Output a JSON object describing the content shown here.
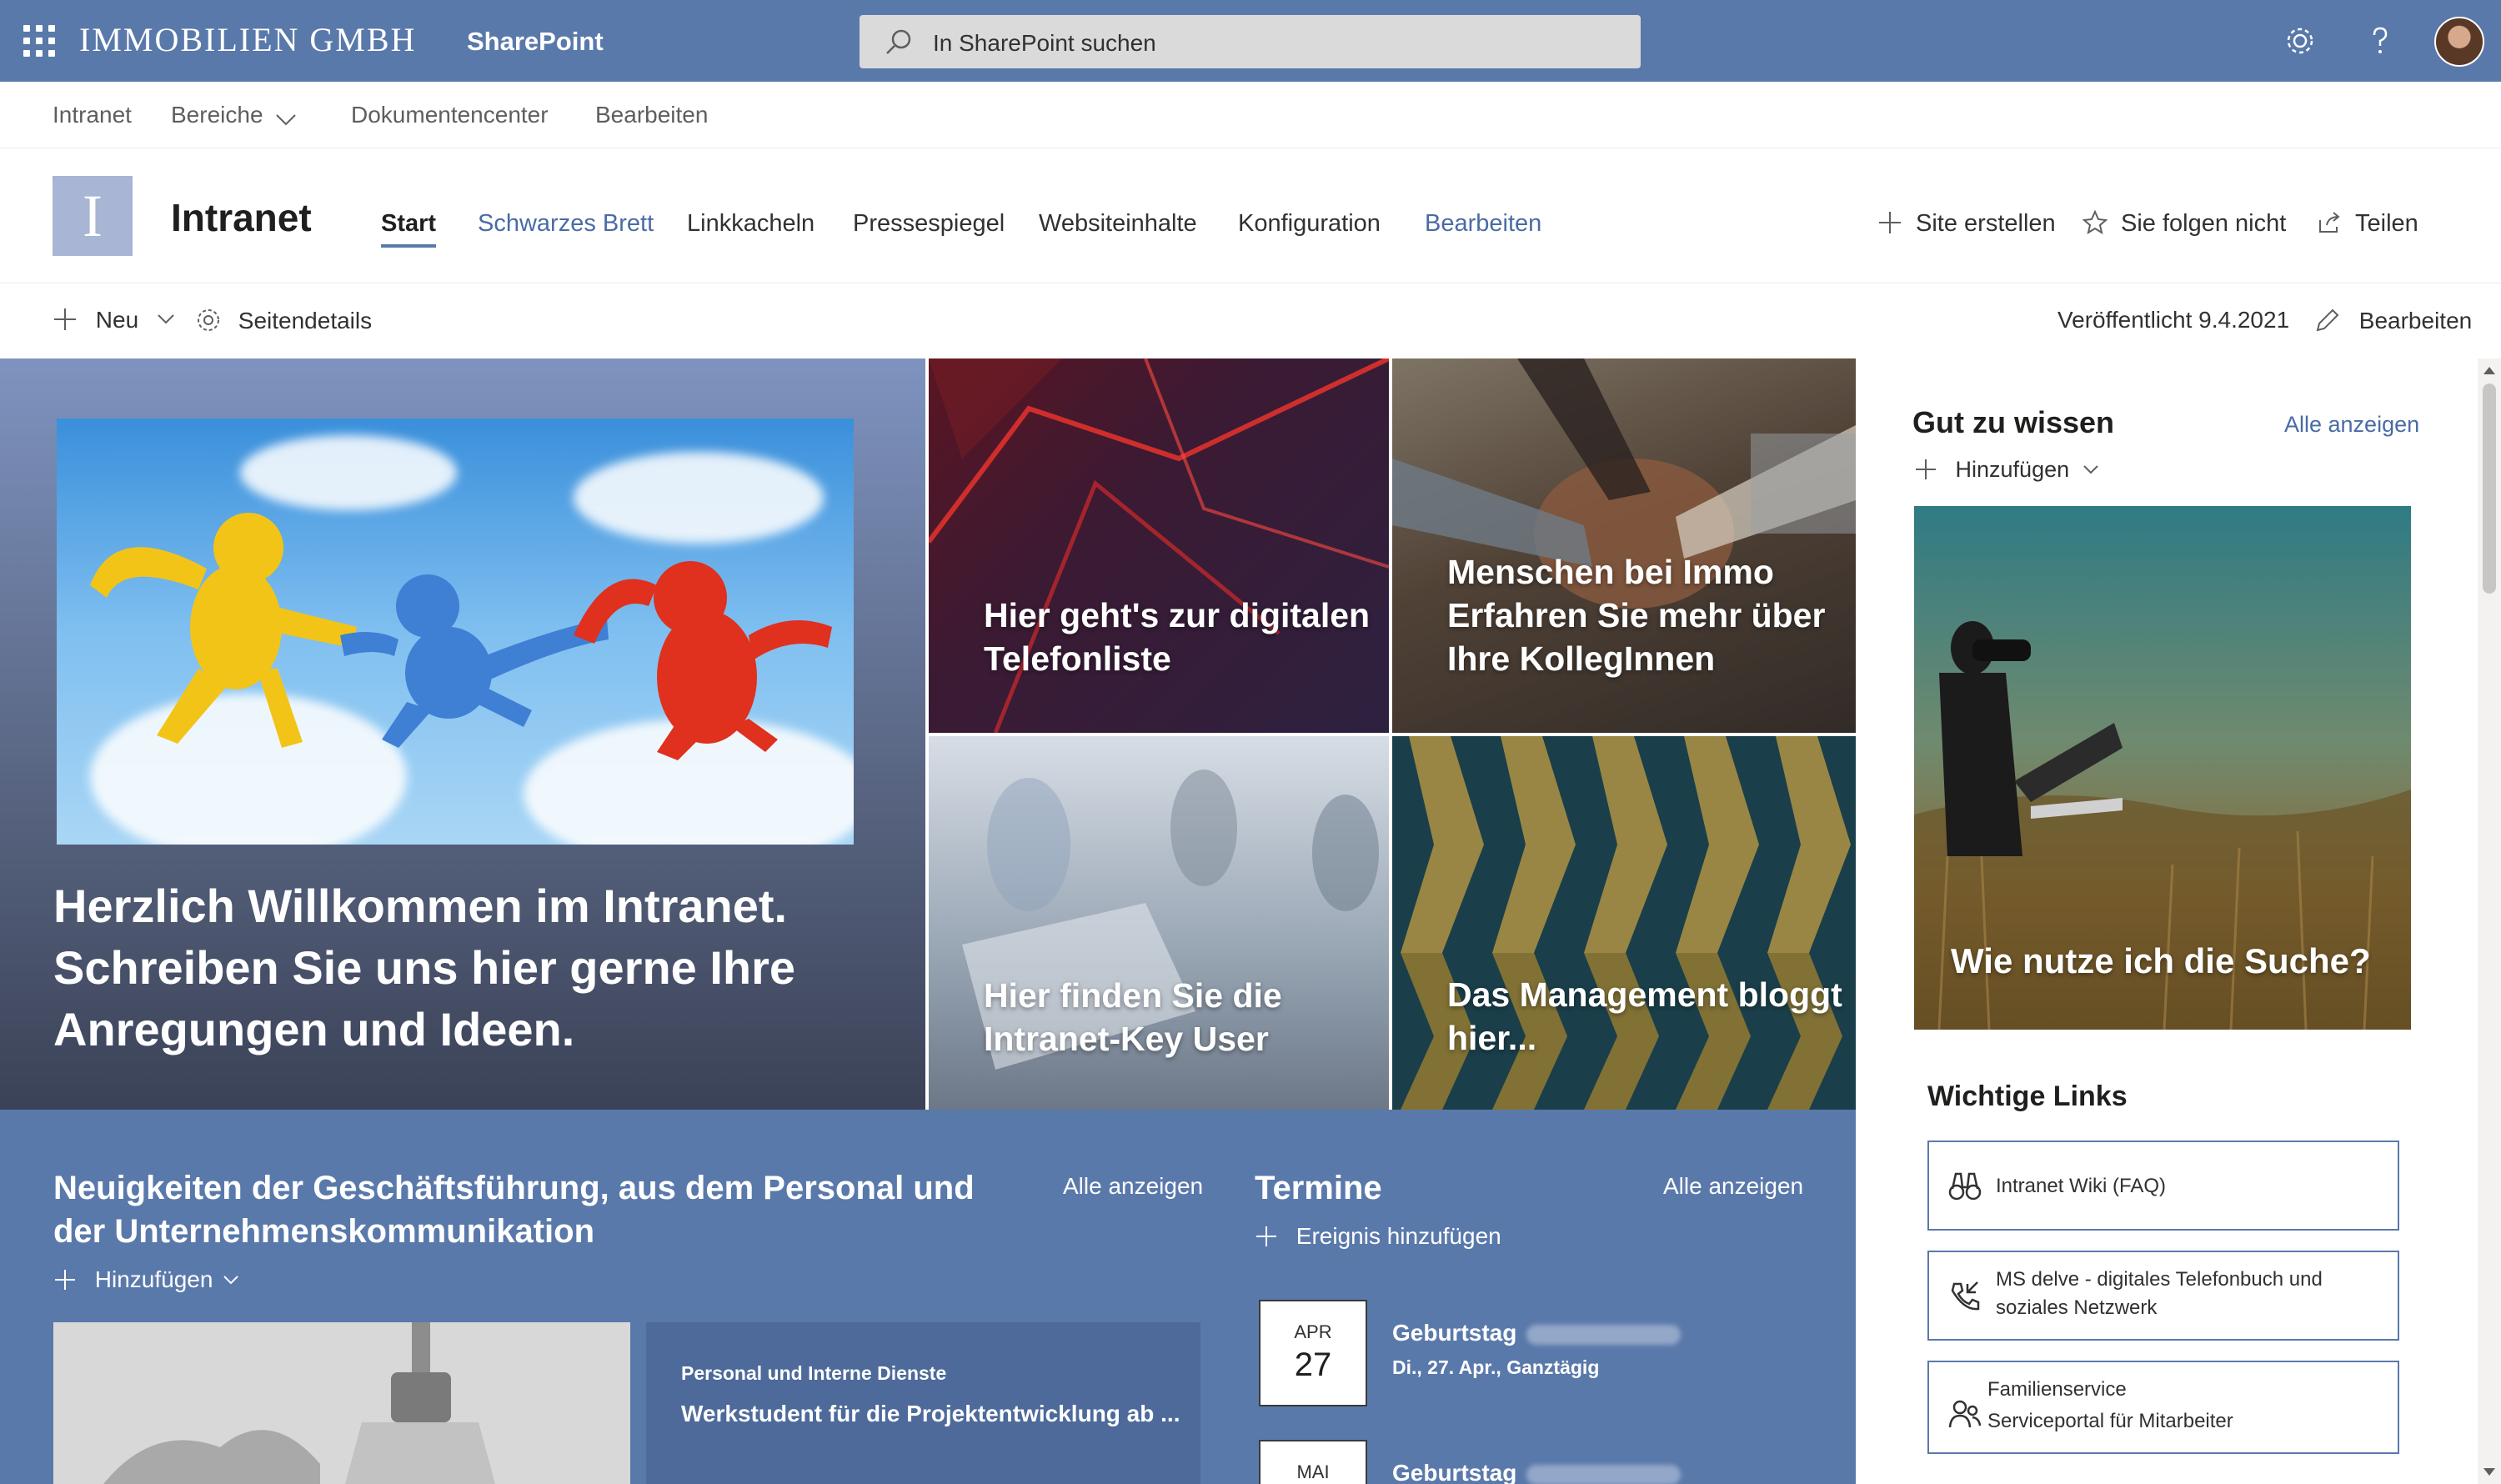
{
  "suite_bar": {
    "org_name": "IMMOBILIEN GMBH",
    "app_name": "SharePoint",
    "search_placeholder": "In SharePoint suchen",
    "icons": [
      "waffle-icon",
      "search-icon",
      "settings-icon",
      "help-icon",
      "avatar"
    ]
  },
  "hub_nav": {
    "items": [
      "Intranet",
      "Bereiche",
      "Dokumentencenter",
      "Bearbeiten"
    ]
  },
  "site": {
    "logo_letter": "I",
    "title": "Intranet",
    "nav": [
      "Start",
      "Schwarzes Brett",
      "Linkkacheln",
      "Pressespiegel",
      "Websiteinhalte",
      "Konfiguration",
      "Bearbeiten"
    ],
    "active_nav": "Start",
    "actions": {
      "create": "Site erstellen",
      "follow": "Sie folgen nicht",
      "share": "Teilen"
    }
  },
  "command_bar": {
    "new": "Neu",
    "page_details": "Seitendetails",
    "published": "Veröffentlicht 9.4.2021",
    "edit": "Bearbeiten"
  },
  "hero": {
    "main_caption": "Herzlich Willkommen im Intranet. Schreiben Sie uns hier gerne Ihre Anregungen und Ideen.",
    "tiles": [
      {
        "caption": "Hier geht's zur digitalen Telefonliste"
      },
      {
        "caption": "Menschen bei Immo Erfahren Sie mehr über Ihre KollegInnen"
      },
      {
        "caption": "Hier finden Sie die Intranet-Key User"
      },
      {
        "caption": "Das Management bloggt hier..."
      }
    ]
  },
  "good_to_know": {
    "title": "Gut zu wissen",
    "see_all": "Alle anzeigen",
    "add": "Hinzufügen",
    "card_caption": "Wie nutze ich die Suche?"
  },
  "important_links": {
    "title": "Wichtige Links",
    "links": [
      {
        "label": "Intranet Wiki (FAQ)",
        "icon": "binoculars-icon"
      },
      {
        "label": "MS delve - digitales Telefonbuch und soziales Netzwerk",
        "icon": "phone-icon"
      },
      {
        "label": "Familienservice",
        "label2": "Serviceportal für Mitarbeiter",
        "icon": "people-icon"
      }
    ]
  },
  "news": {
    "title": "Neuigkeiten der Geschäftsführung, aus dem Personal und der Unternehmenskommunikation",
    "see_all": "Alle anzeigen",
    "add": "Hinzufügen",
    "item": {
      "category": "Personal und Interne Dienste",
      "headline": "Werkstudent für die Projektentwicklung ab ..."
    }
  },
  "events": {
    "title": "Termine",
    "see_all": "Alle anzeigen",
    "add": "Ereignis hinzufügen",
    "items": [
      {
        "month": "APR",
        "day": "27",
        "title": "Geburtstag",
        "detail": "Di., 27. Apr., Ganztägig"
      },
      {
        "month": "MAI",
        "day": "",
        "title": "Geburtstag",
        "detail": ""
      }
    ]
  },
  "colors": {
    "suite_bar": "#5a79ab",
    "accent_link": "#4a6ba5",
    "lower_section": "#5a79ab"
  }
}
